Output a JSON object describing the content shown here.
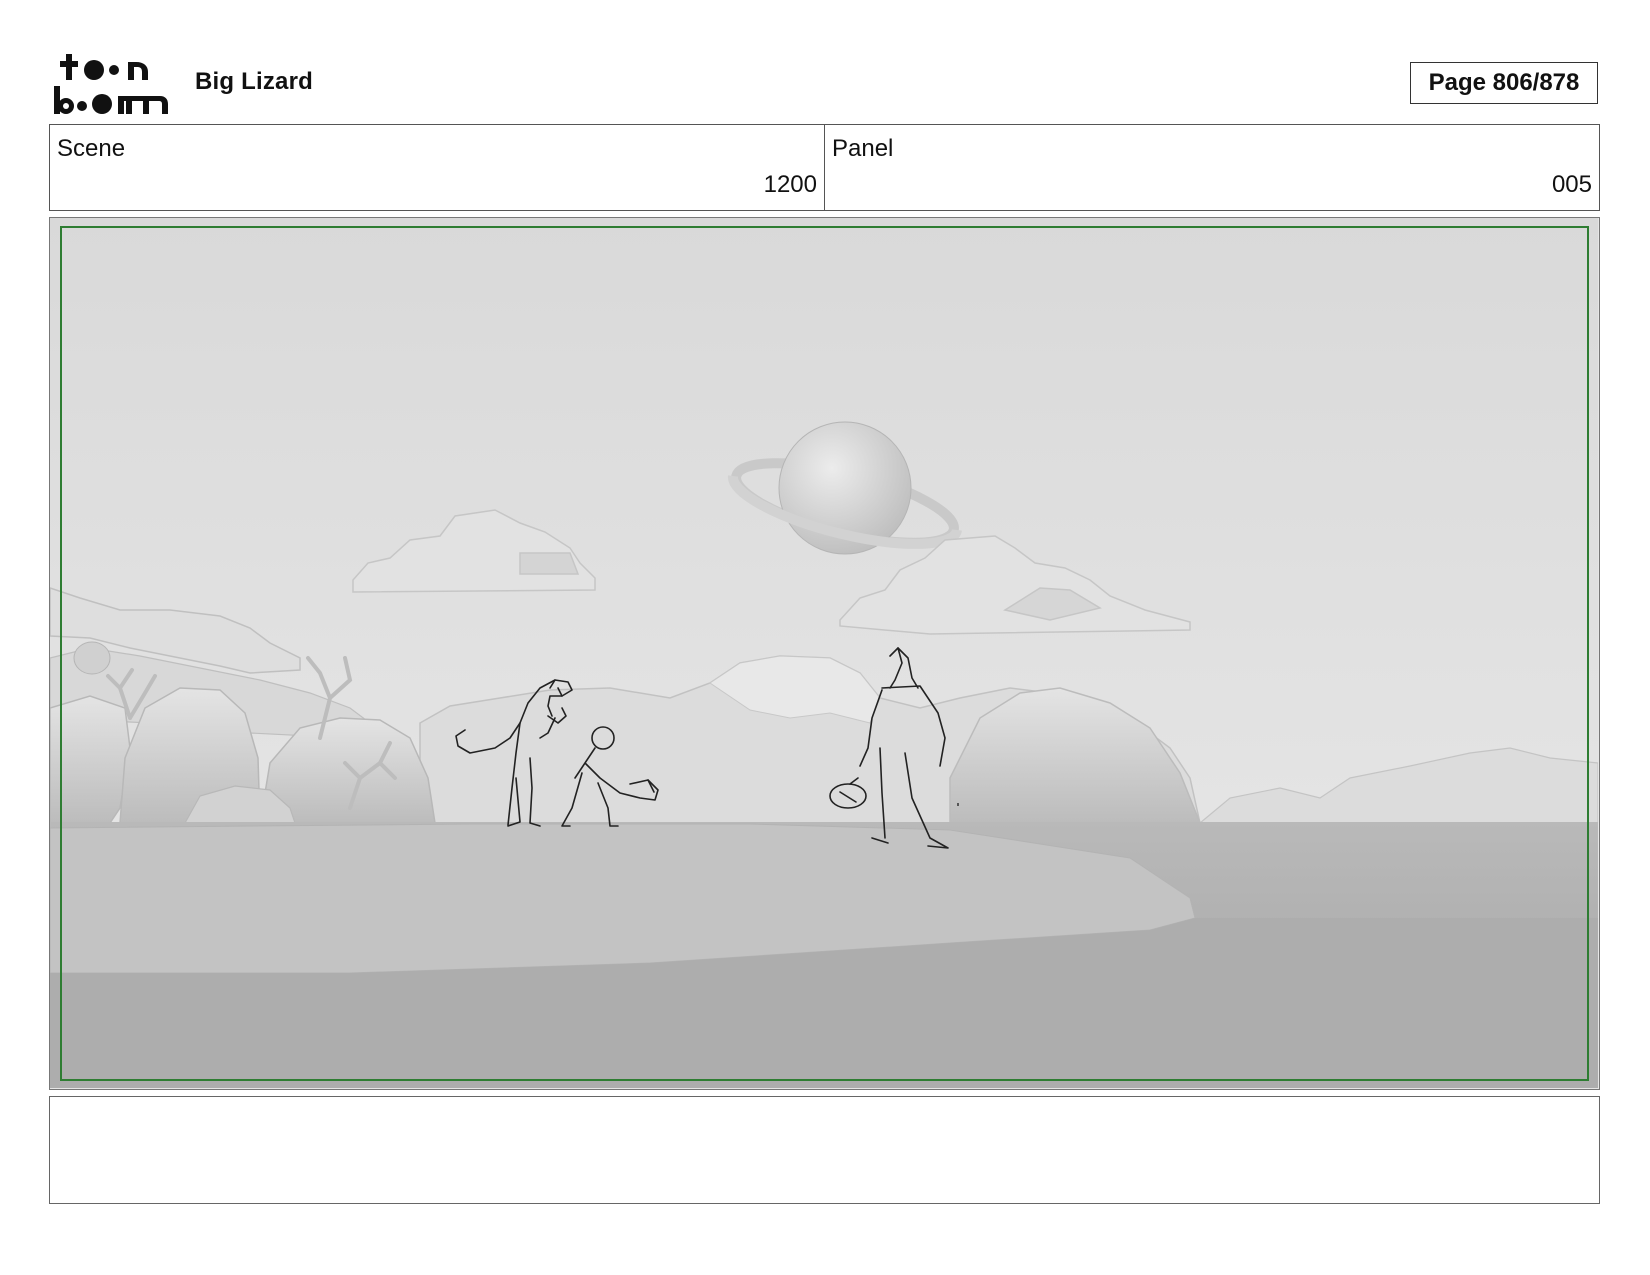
{
  "header": {
    "logo_text": "toon boom",
    "project_title": "Big Lizard",
    "page_label": "Page 806/878"
  },
  "info": {
    "scene_label": "Scene",
    "scene_value": "1200",
    "panel_label": "Panel",
    "panel_value": "005"
  },
  "notes": {
    "text": ""
  },
  "colors": {
    "safe_area": "#2e7d32",
    "background": "#e6e6e6",
    "ground": "#a9a9a9"
  }
}
